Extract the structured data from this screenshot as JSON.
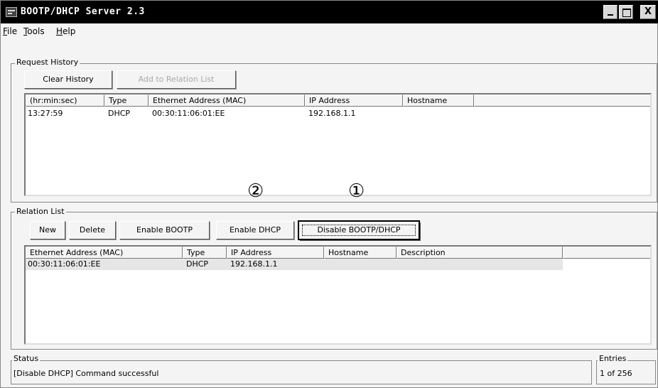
{
  "window": {
    "title": "BOOTP/DHCP Server 2.3",
    "close_glyph": "X"
  },
  "menu": [
    {
      "label": "File",
      "accel": "F",
      "rest": "ile"
    },
    {
      "label": "Tools",
      "accel": "T",
      "rest": "ools"
    },
    {
      "label": "Help",
      "accel": "H",
      "rest": "elp"
    }
  ],
  "request_history": {
    "label": "Request History",
    "buttons": {
      "clear": "Clear History",
      "add_relation": "Add to Relation List"
    },
    "columns": [
      "(hr:min:sec)",
      "Type",
      "Ethernet Address (MAC)",
      "IP Address",
      "Hostname"
    ],
    "rows": [
      {
        "time": "13:27:59",
        "type": "DHCP",
        "mac": "00:30:11:06:01:EE",
        "ip": "192.168.1.1",
        "hostname": ""
      }
    ]
  },
  "callouts": {
    "two": "②",
    "one": "①"
  },
  "relation_list": {
    "label": "Relation List",
    "buttons": {
      "new": "New",
      "delete": "Delete",
      "enable_bootp": "Enable BOOTP",
      "enable_dhcp": "Enable DHCP",
      "disable_bootp_dhcp": "Disable BOOTP/DHCP"
    },
    "columns": [
      "Ethernet Address (MAC)",
      "Type",
      "IP Address",
      "Hostname",
      "Description"
    ],
    "rows": [
      {
        "mac": "00:30:11:06:01:EE",
        "type": "DHCP",
        "ip": "192.168.1.1",
        "hostname": "",
        "description": ""
      }
    ]
  },
  "status": {
    "label": "Status",
    "text": "[Disable DHCP] Command successful"
  },
  "entries": {
    "label": "Entries",
    "text": "1 of 256"
  }
}
